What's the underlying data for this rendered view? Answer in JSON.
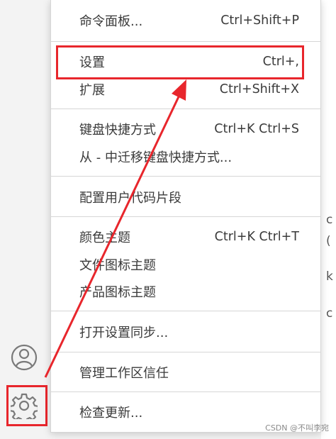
{
  "menu": {
    "items": [
      {
        "label": "命令面板...",
        "shortcut": "Ctrl+Shift+P"
      },
      {
        "label": "设置",
        "shortcut": "Ctrl+,"
      },
      {
        "label": "扩展",
        "shortcut": "Ctrl+Shift+X"
      },
      {
        "label": "键盘快捷方式",
        "shortcut": "Ctrl+K Ctrl+S"
      },
      {
        "label": "从 - 中迁移键盘快捷方式...",
        "shortcut": ""
      },
      {
        "label": "配置用户代码片段",
        "shortcut": ""
      },
      {
        "label": "颜色主题",
        "shortcut": "Ctrl+K Ctrl+T"
      },
      {
        "label": "文件图标主题",
        "shortcut": ""
      },
      {
        "label": "产品图标主题",
        "shortcut": ""
      },
      {
        "label": "打开设置同步...",
        "shortcut": ""
      },
      {
        "label": "管理工作区信任",
        "shortcut": ""
      },
      {
        "label": "检查更新...",
        "shortcut": ""
      }
    ]
  },
  "editor_peek": {
    "lines": [
      "c",
      "(",
      "k",
      "c"
    ]
  },
  "watermark": "CSDN @不叫李宛",
  "colors": {
    "highlight": "#e8262c",
    "menu_bg": "#ffffff",
    "activity_bg": "#f3f3f3"
  },
  "icons": {
    "accounts": "account-icon",
    "manage": "gear-icon"
  }
}
